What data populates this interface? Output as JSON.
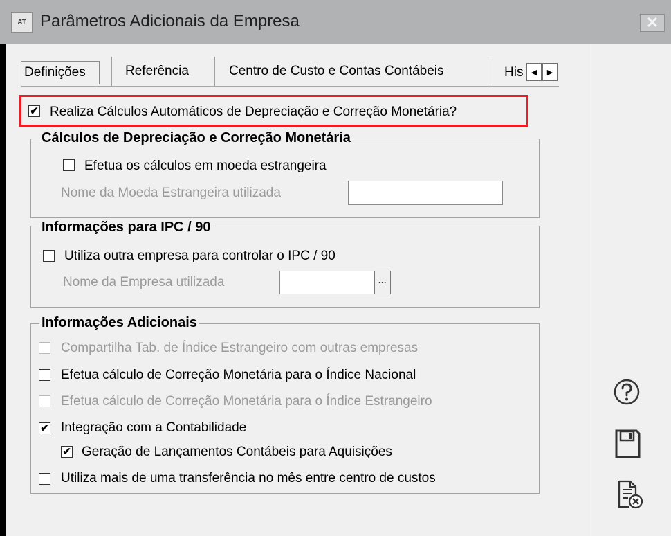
{
  "window": {
    "app_icon_text": "AT",
    "title": "Parâmetros Adicionais da Empresa",
    "close_glyph": "✕"
  },
  "tabs": [
    {
      "label": "Definições",
      "active": true
    },
    {
      "label": "Referência",
      "active": false
    },
    {
      "label": "Centro de Custo e Contas Contábeis",
      "active": false
    },
    {
      "label": "His",
      "active": false
    }
  ],
  "tab_scroll": {
    "left_glyph": "◀",
    "right_glyph": "▶"
  },
  "main_option": {
    "label": "Realiza Cálculos Automáticos de Depreciação e Correção Monetária?",
    "checked": true
  },
  "group_depreciacao": {
    "title": "Cálculos de Depreciação e Correção Monetária",
    "moeda_estrangeira_label": "Efetua os cálculos em moeda estrangeira",
    "nome_moeda_label": "Nome da Moeda Estrangeira utilizada",
    "nome_moeda_value": ""
  },
  "group_ipc": {
    "title": "Informações para IPC / 90",
    "outra_empresa_label": "Utiliza outra empresa para controlar o IPC / 90",
    "nome_empresa_label": "Nome da Empresa utilizada",
    "nome_empresa_value": "",
    "lookup_glyph": "···"
  },
  "group_adicionais": {
    "title": "Informações Adicionais",
    "items": [
      {
        "label": "Compartilha Tab. de Índice Estrangeiro com outras empresas",
        "checked": false,
        "enabled": false
      },
      {
        "label": "Efetua cálculo de Correção  Monetária para o Índice Nacional",
        "checked": false,
        "enabled": true
      },
      {
        "label": "Efetua cálculo de Correção Monetária para o Índice  Estrangeiro",
        "checked": false,
        "enabled": false
      },
      {
        "label": "Integração com a Contabilidade",
        "checked": true,
        "enabled": true
      },
      {
        "label": "Geração de Lançamentos Contábeis para  Aquisições",
        "checked": true,
        "enabled": true
      },
      {
        "label": "Utiliza mais de uma transferência no mês entre centro de custos",
        "checked": false,
        "enabled": true
      }
    ]
  },
  "side_buttons": {
    "help_icon": "help-circle-icon",
    "save_icon": "floppy-disk-icon",
    "cancel_icon": "document-cancel-icon"
  },
  "colors": {
    "highlight": "#ee1c24",
    "titlebar": "#b1b2b3"
  },
  "check_glyph": "✔"
}
